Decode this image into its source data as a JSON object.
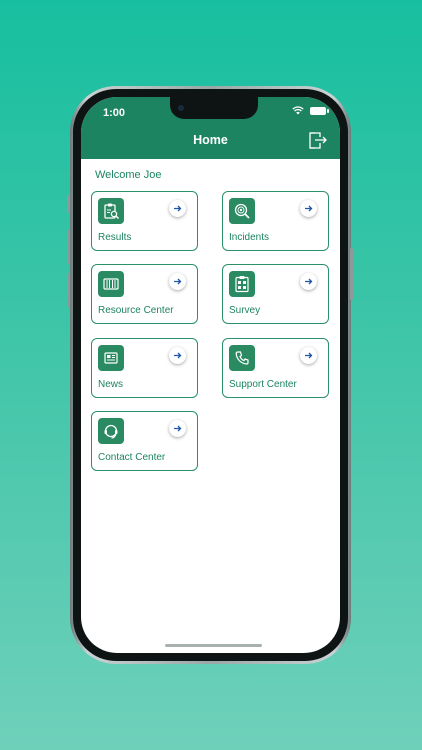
{
  "status": {
    "time": "1:00"
  },
  "header": {
    "title": "Home",
    "logout_icon": "logout-icon"
  },
  "welcome": "Welcome Joe",
  "colors": {
    "primary": "#1d8462",
    "background_top": "#17bfa0",
    "arrow": "#1f56a8"
  },
  "tiles": [
    {
      "label": "Results",
      "icon": "clipboard-search-icon"
    },
    {
      "label": "Incidents",
      "icon": "fingerprint-search-icon"
    },
    {
      "label": "Resource Center",
      "icon": "library-icon"
    },
    {
      "label": "Survey",
      "icon": "survey-clipboard-icon"
    },
    {
      "label": "News",
      "icon": "newspaper-icon"
    },
    {
      "label": "Support Center",
      "icon": "phone-icon"
    },
    {
      "label": "Contact Center",
      "icon": "headset-icon"
    }
  ]
}
